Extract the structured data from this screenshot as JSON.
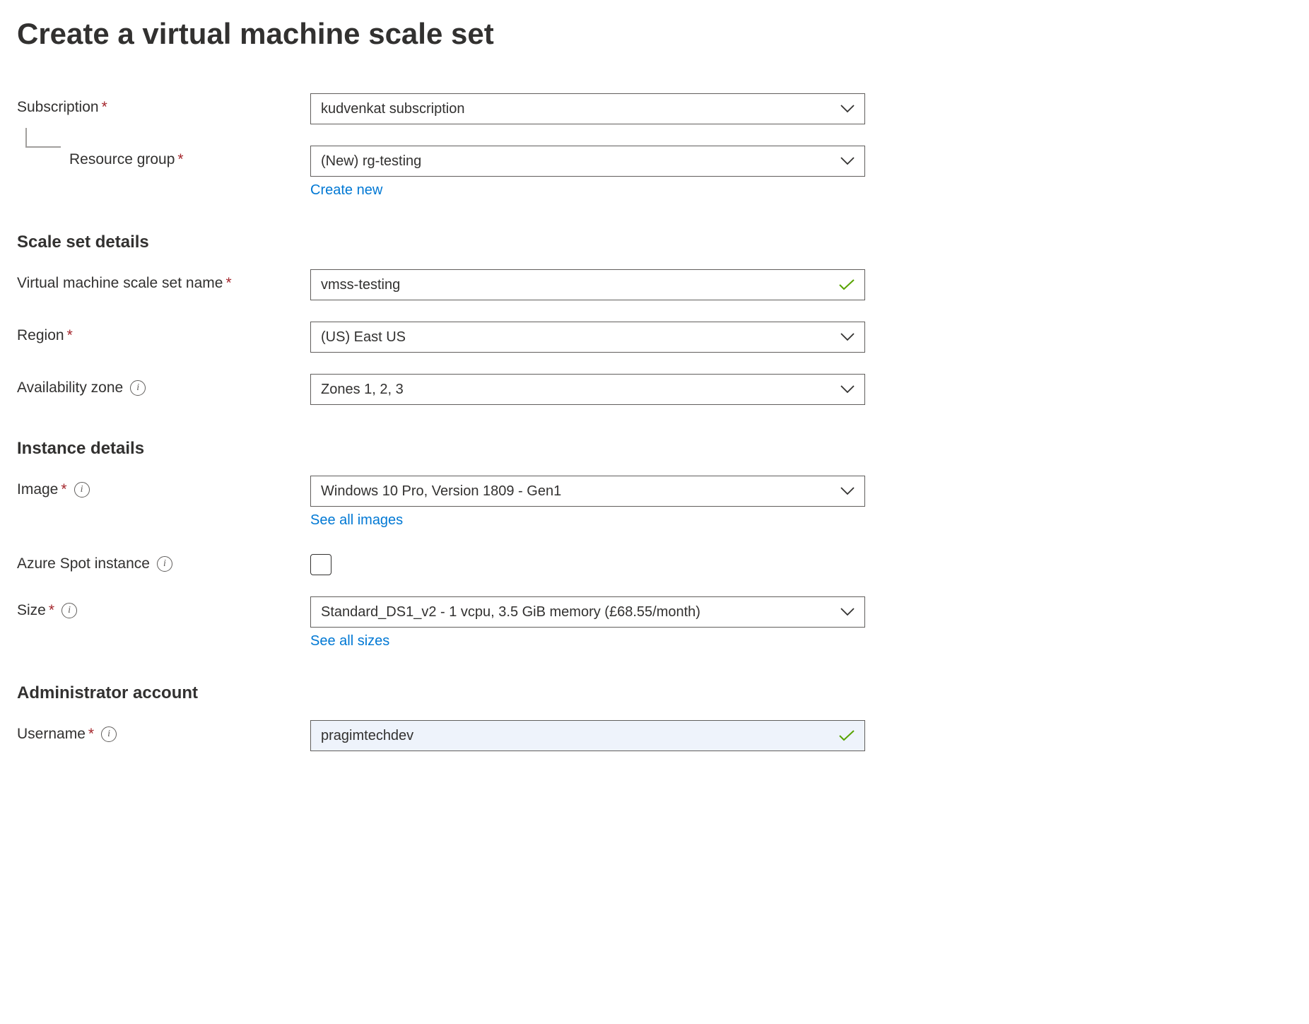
{
  "title": "Create a virtual machine scale set",
  "labels": {
    "subscription": "Subscription",
    "resource_group": "Resource group",
    "scale_set_details": "Scale set details",
    "vmss_name": "Virtual machine scale set name",
    "region": "Region",
    "availability_zone": "Availability zone",
    "instance_details": "Instance details",
    "image": "Image",
    "spot_instance": "Azure Spot instance",
    "size": "Size",
    "admin_account": "Administrator account",
    "username": "Username"
  },
  "values": {
    "subscription": "kudvenkat subscription",
    "resource_group": "(New) rg-testing",
    "vmss_name": "vmss-testing",
    "region": "(US) East US",
    "availability_zone": "Zones 1, 2, 3",
    "image": "Windows 10 Pro, Version 1809 - Gen1",
    "size": "Standard_DS1_v2 - 1 vcpu, 3.5 GiB memory (£68.55/month)",
    "username": "pragimtechdev"
  },
  "links": {
    "create_new": "Create new",
    "see_all_images": "See all images",
    "see_all_sizes": "See all sizes"
  }
}
